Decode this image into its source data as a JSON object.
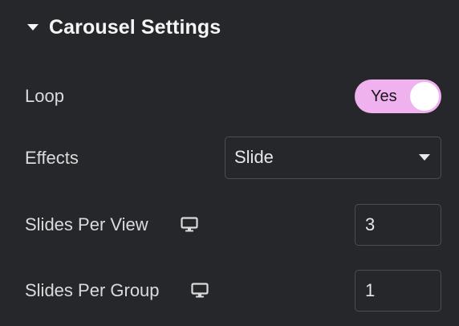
{
  "section": {
    "title": "Carousel Settings"
  },
  "loop": {
    "label": "Loop",
    "toggle_label": "Yes"
  },
  "effects": {
    "label": "Effects",
    "selected": "Slide"
  },
  "slides_per_view": {
    "label": "Slides Per View",
    "value": "3",
    "device_icon": "desktop-monitor-icon"
  },
  "slides_per_group": {
    "label": "Slides Per Group",
    "value": "1",
    "device_icon": "desktop-monitor-icon"
  },
  "colors": {
    "background": "#26272b",
    "toggle_on": "#f0b2ef",
    "border": "#4b4d52"
  }
}
